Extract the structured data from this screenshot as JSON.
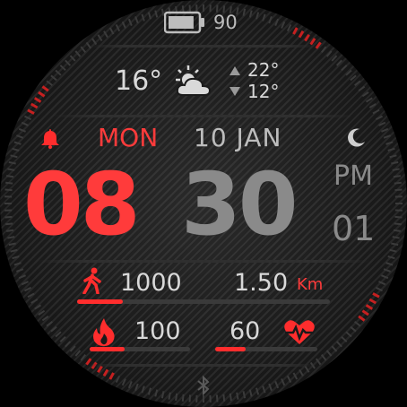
{
  "colors": {
    "accent": "#ff3b3b",
    "text": "#d9d9d9",
    "muted": "#9a9a9a",
    "bg": "#1a1a1a"
  },
  "battery": {
    "percent": "90",
    "level": 0.9
  },
  "weather": {
    "temp": "16°",
    "high": "22°",
    "low": "12°",
    "icon": "partly-cloudy-icon"
  },
  "date": {
    "day": "MON",
    "date": "10 JAN"
  },
  "time": {
    "hour": "08",
    "minute": "30",
    "ampm": "PM",
    "seconds": "01"
  },
  "steps": {
    "value": "1000",
    "progress": 0.18
  },
  "distance": {
    "value": "1.50",
    "unit": "Km"
  },
  "calories": {
    "value": "100",
    "progress": 0.35
  },
  "heart_rate": {
    "value": "60",
    "progress": 0.3
  },
  "icons": {
    "alarm": "bell-icon",
    "night": "moon-icon",
    "steps": "walking-icon",
    "calories": "flame-icon",
    "heart": "heart-rate-icon",
    "bluetooth": "bluetooth-icon"
  }
}
